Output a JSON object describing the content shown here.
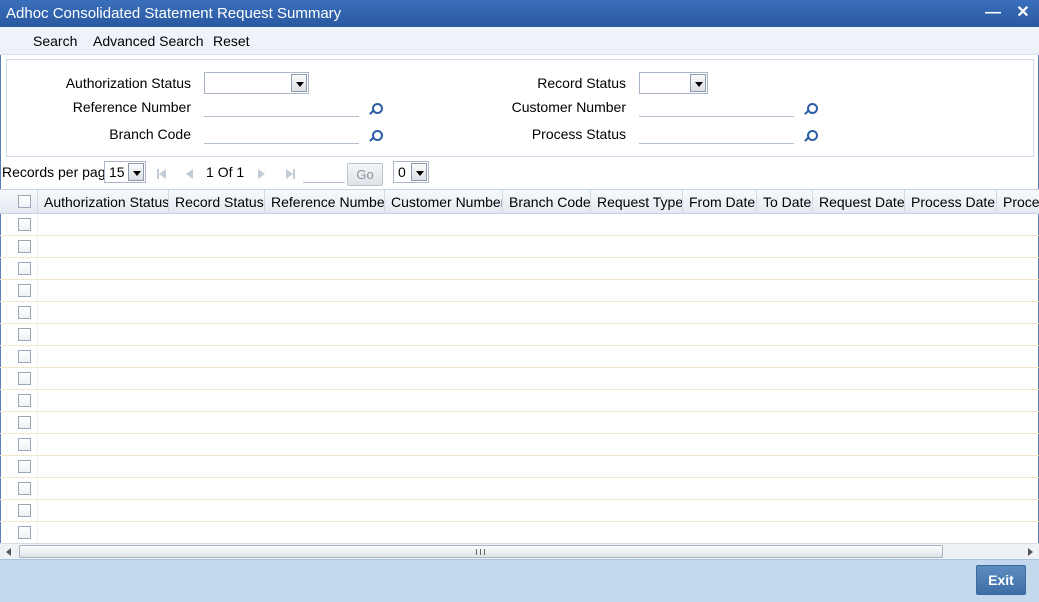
{
  "window": {
    "title": "Adhoc Consolidated Statement Request Summary"
  },
  "toolbar": {
    "search": "Search",
    "advanced_search": "Advanced Search",
    "reset": "Reset"
  },
  "criteria": {
    "authorization_status": {
      "label": "Authorization Status",
      "value": ""
    },
    "record_status": {
      "label": "Record Status",
      "value": ""
    },
    "reference_number": {
      "label": "Reference Number",
      "value": ""
    },
    "customer_number": {
      "label": "Customer Number",
      "value": ""
    },
    "branch_code": {
      "label": "Branch Code",
      "value": ""
    },
    "process_status": {
      "label": "Process Status",
      "value": ""
    }
  },
  "pager": {
    "records_per_page_label": "Records per page",
    "records_per_page": "15",
    "current_page": "1",
    "of_label": "Of",
    "total_pages": "1",
    "goto_value": "",
    "go_label": "Go",
    "page_select": "0"
  },
  "grid": {
    "columns": [
      "Authorization Status",
      "Record Status",
      "Reference Number",
      "Customer Number",
      "Branch Code",
      "Request Type",
      "From Date",
      "To Date",
      "Request Date",
      "Process Date",
      "Proce"
    ],
    "row_count": 15
  },
  "footer": {
    "exit_label": "Exit"
  },
  "icons": {
    "minimize": "minimize-icon",
    "close": "close-icon",
    "lookup": "magnifier-icon",
    "first": "first-page-icon",
    "prev": "prev-page-icon",
    "next": "next-page-icon",
    "last": "last-page-icon"
  },
  "colors": {
    "titlebar": "#2e5fa8",
    "footer": "#c3d9ee",
    "accent": "#3f6fa6"
  }
}
